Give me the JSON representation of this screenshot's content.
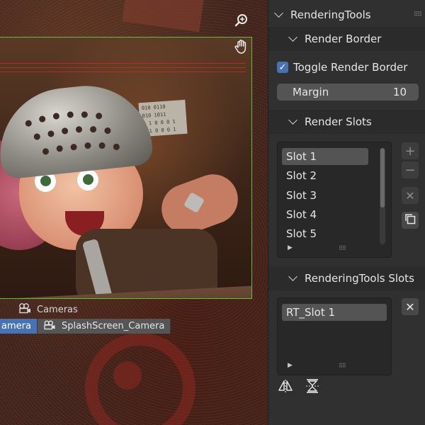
{
  "viewport": {
    "zoom_icon": "zoom-magnifier-icon",
    "pan_icon": "hand-pan-icon",
    "cameras_label": "Cameras",
    "camera_tabs": [
      {
        "label": "amera",
        "active": true
      },
      {
        "label": "SplashScreen_Camera",
        "active": false
      }
    ],
    "binary_lines": [
      "010 0110",
      "010 1011",
      "0 1 0 0 0 1",
      "0 1 0 0 0 1"
    ]
  },
  "panel": {
    "title": "RenderingTools",
    "render_border": {
      "header": "Render Border",
      "toggle_label": "Toggle Render Border",
      "toggle_checked": true,
      "margin_label": "Margin",
      "margin_value": "10"
    },
    "render_slots": {
      "header": "Render Slots",
      "items": [
        "Slot 1",
        "Slot 2",
        "Slot 3",
        "Slot 4",
        "Slot 5"
      ],
      "selected_index": 0,
      "buttons": [
        "add-icon",
        "remove-icon",
        "close-icon",
        "copy-icon"
      ]
    },
    "rt_slots": {
      "header": "RenderingTools Slots",
      "items": [
        "RT_Slot 1"
      ],
      "selected_index": 0
    }
  },
  "colors": {
    "accent": "#4772b3",
    "panel_bg": "#303030",
    "border_frame": "#5fbf3a"
  }
}
